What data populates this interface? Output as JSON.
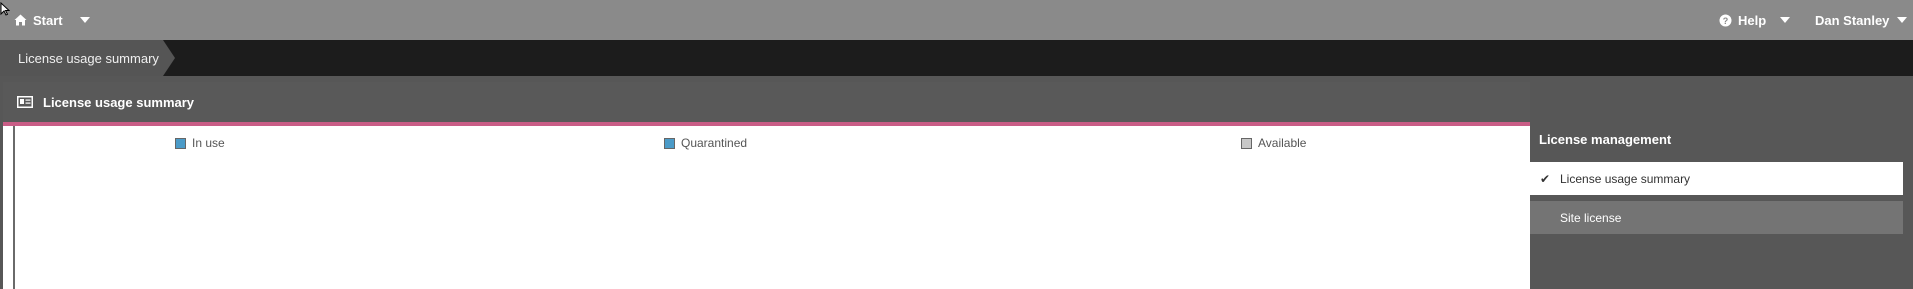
{
  "topbar": {
    "home_label": "Start",
    "help_label": "Help",
    "user_name": "Dan Stanley"
  },
  "breadcrumb": {
    "current": "License usage summary"
  },
  "panel": {
    "title": "License usage summary",
    "accent_color": "#c95d86"
  },
  "legend": [
    {
      "label": "In use",
      "color": "#4b9bc8"
    },
    {
      "label": "Quarantined",
      "color": "#4b9bc8"
    },
    {
      "label": "Available",
      "color": "#c8c8c8"
    }
  ],
  "side": {
    "title": "License management",
    "items": [
      {
        "label": "License usage summary",
        "selected": true
      },
      {
        "label": "Site license",
        "selected": false
      }
    ]
  }
}
